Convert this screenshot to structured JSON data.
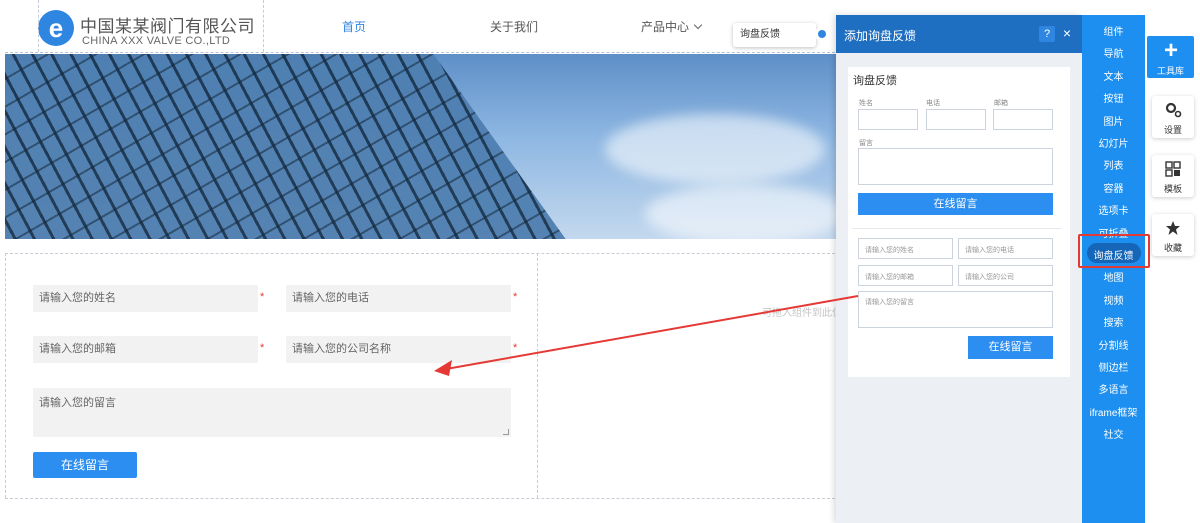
{
  "header": {
    "logo_glyph": "e",
    "company_cn": "中国某某阀门有限公司",
    "company_en": "CHINA XXX VALVE CO.,LTD",
    "nav": [
      {
        "label": "首页",
        "active": true
      },
      {
        "label": "关于我们",
        "active": false
      },
      {
        "label": "产品中心",
        "active": false
      }
    ]
  },
  "tooltip": {
    "label": "询盘反馈"
  },
  "form": {
    "name_placeholder": "请输入您的姓名",
    "phone_placeholder": "请输入您的电话",
    "email_placeholder": "请输入您的邮箱",
    "company_placeholder": "请输入您的公司名称",
    "message_placeholder": "请输入您的留言",
    "required_mark": "*",
    "submit_label": "在线留言"
  },
  "drop_hint": "可拖入组件到此位",
  "panel": {
    "title": "添加询盘反馈",
    "help_label": "?",
    "close_label": "×",
    "preview1": {
      "title": "询盘反馈",
      "name_label": "姓名",
      "phone_label": "电话",
      "email_label": "邮箱",
      "message_label": "留言",
      "submit_label": "在线留言"
    },
    "preview2": {
      "name_placeholder": "请输入您的姓名",
      "phone_placeholder": "请输入您的电话",
      "email_placeholder": "请输入您的邮箱",
      "company_placeholder": "请输入您的公司",
      "message_placeholder": "请输入您的留言",
      "submit_label": "在线留言"
    }
  },
  "components": {
    "items": [
      "组件",
      "导航",
      "文本",
      "按钮",
      "图片",
      "幻灯片",
      "列表",
      "容器",
      "选项卡",
      "可折叠",
      "询盘反馈",
      "地图",
      "视频",
      "搜索",
      "分割线",
      "侧边栏",
      "多语言",
      "iframe框架",
      "社交"
    ],
    "selected": "询盘反馈"
  },
  "toolbar": {
    "add_icon": "+",
    "add_label": "工具库",
    "settings_label": "设置",
    "template_label": "模板",
    "favorite_label": "收藏"
  },
  "colors": {
    "brand_blue": "#1c8ff0",
    "panel_header": "#1e6fc2",
    "highlight_red": "#e53935",
    "button_blue": "#2b8ef0"
  }
}
